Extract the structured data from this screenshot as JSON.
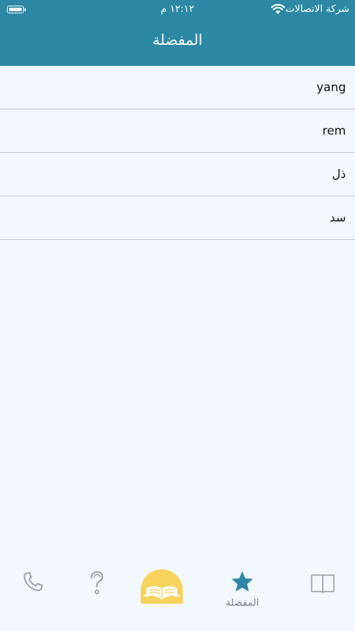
{
  "status_bar": {
    "carrier": "شركة الاتصالات",
    "time": "١٢:١٢ م"
  },
  "header": {
    "title": "المفضلة"
  },
  "favorites": [
    {
      "word": "yang"
    },
    {
      "word": "rem"
    },
    {
      "word": "ذل"
    },
    {
      "word": "سد"
    }
  ],
  "tabbar": {
    "items": [
      {
        "icon": "phone-icon",
        "label": ""
      },
      {
        "icon": "question-icon",
        "label": ""
      },
      {
        "icon": "open-book-home-icon",
        "label": ""
      },
      {
        "icon": "star-icon",
        "label": "المفضلة",
        "active": true
      },
      {
        "icon": "book-icon",
        "label": ""
      }
    ]
  },
  "colors": {
    "header": "#2c88a5",
    "background": "#f2f8fc",
    "active_tab": "#2c88a5",
    "home_icon": "#f7d35c"
  }
}
